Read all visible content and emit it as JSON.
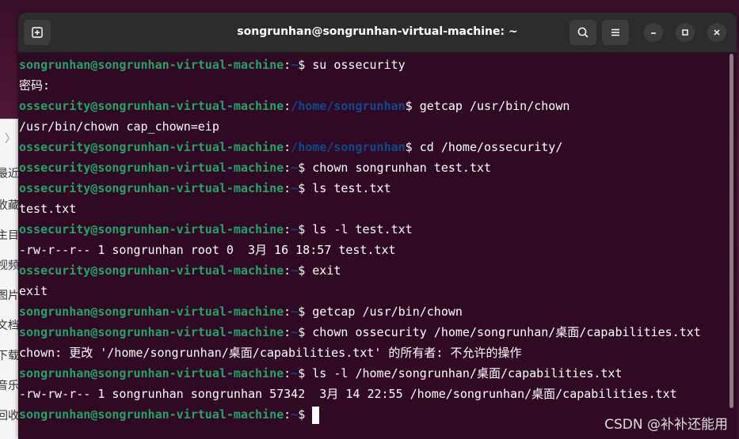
{
  "background": {
    "side_items": [
      "最近",
      "收藏",
      "主目",
      "视频",
      "图片",
      "文档",
      "下载",
      "音乐",
      "回收"
    ]
  },
  "window": {
    "title": "songrunhan@songrunhan-virtual-machine: ~",
    "icons": {
      "new_tab": "new-tab-icon",
      "search": "search-icon",
      "menu": "hamburger-menu-icon",
      "minimize": "minimize-icon",
      "maximize": "maximize-icon",
      "close": "close-icon"
    }
  },
  "colors": {
    "terminal_bg": "#300a24",
    "prompt_user": "#26a269",
    "prompt_path": "#12488b",
    "text": "#ffffff"
  },
  "terminal": {
    "lines": [
      {
        "type": "prompt",
        "user": "songrunhan@songrunhan-virtual-machine",
        "path": "~",
        "symbol": "$",
        "command": " su ossecurity"
      },
      {
        "type": "output",
        "text": "密码:"
      },
      {
        "type": "prompt",
        "user": "ossecurity@songrunhan-virtual-machine",
        "path": "/home/songrunhan",
        "symbol": "$",
        "command": " getcap /usr/bin/chown"
      },
      {
        "type": "output",
        "text": "/usr/bin/chown cap_chown=eip"
      },
      {
        "type": "prompt",
        "user": "ossecurity@songrunhan-virtual-machine",
        "path": "/home/songrunhan",
        "symbol": "$",
        "command": " cd /home/ossecurity/"
      },
      {
        "type": "prompt",
        "user": "ossecurity@songrunhan-virtual-machine",
        "path": "~",
        "symbol": "$",
        "command": " chown songrunhan test.txt"
      },
      {
        "type": "prompt",
        "user": "ossecurity@songrunhan-virtual-machine",
        "path": "~",
        "symbol": "$",
        "command": " ls test.txt"
      },
      {
        "type": "output",
        "text": "test.txt"
      },
      {
        "type": "prompt",
        "user": "ossecurity@songrunhan-virtual-machine",
        "path": "~",
        "symbol": "$",
        "command": " ls -l test.txt"
      },
      {
        "type": "output",
        "text": "-rw-r--r-- 1 songrunhan root 0  3月 16 18:57 test.txt"
      },
      {
        "type": "prompt",
        "user": "ossecurity@songrunhan-virtual-machine",
        "path": "~",
        "symbol": "$",
        "command": " exit"
      },
      {
        "type": "output",
        "text": "exit"
      },
      {
        "type": "prompt",
        "user": "songrunhan@songrunhan-virtual-machine",
        "path": "~",
        "symbol": "$",
        "command": " getcap /usr/bin/chown"
      },
      {
        "type": "prompt",
        "user": "songrunhan@songrunhan-virtual-machine",
        "path": "~",
        "symbol": "$",
        "command": " chown ossecurity /home/songrunhan/桌面/capabilities.txt"
      },
      {
        "type": "output",
        "text": "chown: 更改 '/home/songrunhan/桌面/capabilities.txt' 的所有者: 不允许的操作"
      },
      {
        "type": "prompt",
        "user": "songrunhan@songrunhan-virtual-machine",
        "path": "~",
        "symbol": "$",
        "command": " ls -l /home/songrunhan/桌面/capabilities.txt"
      },
      {
        "type": "output",
        "text": "-rw-rw-r-- 1 songrunhan songrunhan 57342  3月 14 22:55 /home/songrunhan/桌面/capabilities.txt"
      },
      {
        "type": "prompt",
        "user": "songrunhan@songrunhan-virtual-machine",
        "path": "~",
        "symbol": "$",
        "command": " ",
        "cursor": true
      }
    ]
  },
  "watermark": "CSDN @补补还能用"
}
